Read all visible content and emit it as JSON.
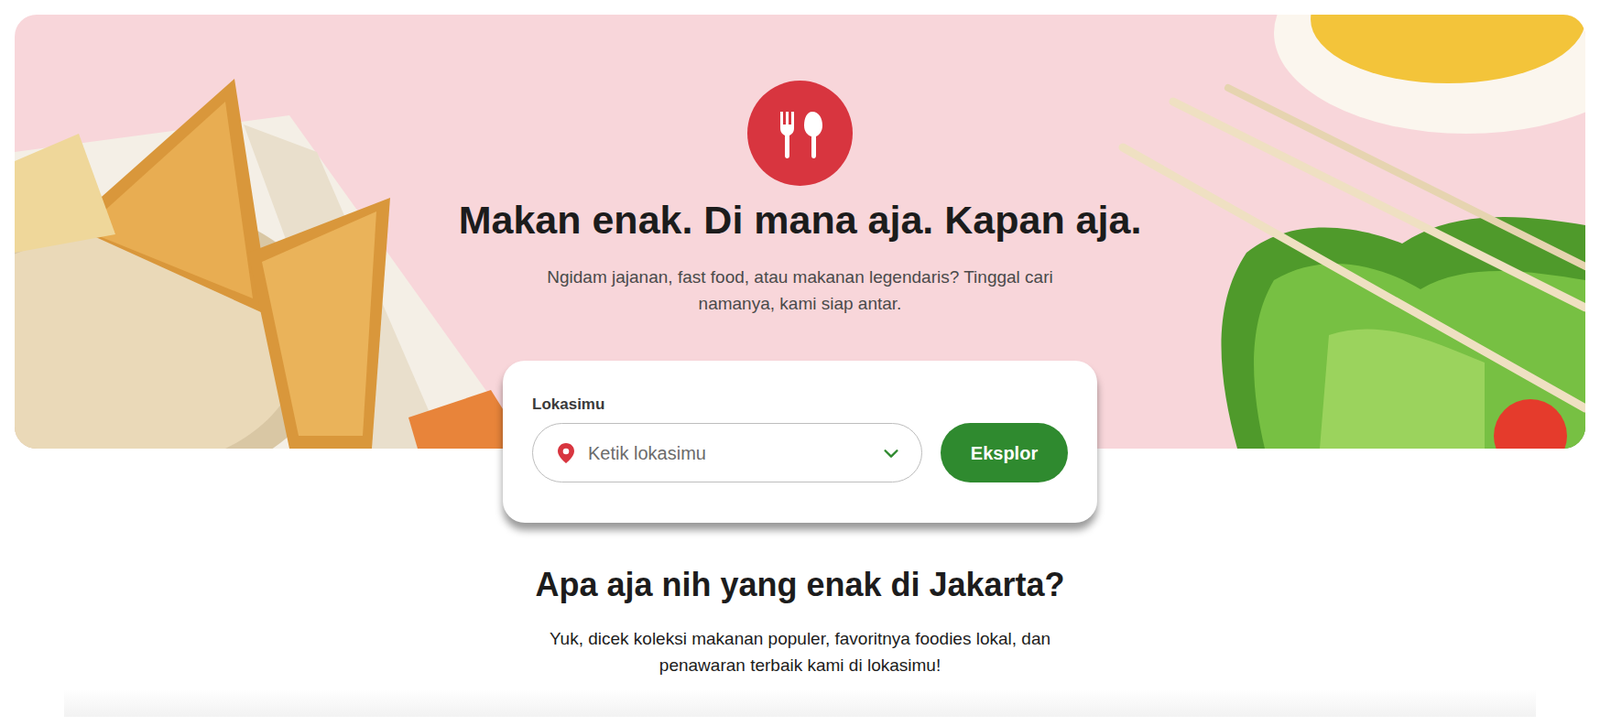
{
  "hero": {
    "title": "Makan enak. Di mana aja. Kapan aja.",
    "subtitle": "Ngidam jajanan, fast food, atau makanan legendaris? Tinggal cari namanya, kami siap antar."
  },
  "search": {
    "label": "Lokasimu",
    "placeholder": "Ketik lokasimu",
    "button": "Eksplor"
  },
  "section": {
    "title": "Apa aja nih yang enak di Jakarta?",
    "subtitle": "Yuk, dicek koleksi makanan populer, favoritnya foodies lokal, dan penawaran terbaik kami di lokasimu!"
  }
}
